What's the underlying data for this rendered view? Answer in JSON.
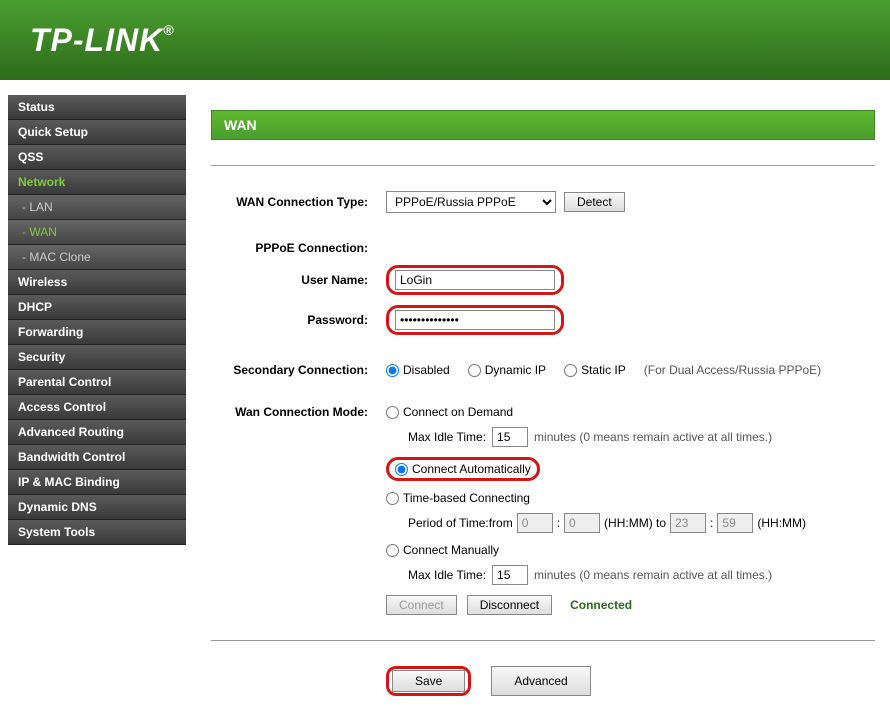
{
  "brand": "TP-LINK",
  "sidebar": {
    "items": [
      {
        "label": "Status",
        "type": "item"
      },
      {
        "label": "Quick Setup",
        "type": "item"
      },
      {
        "label": "QSS",
        "type": "item"
      },
      {
        "label": "Network",
        "type": "item",
        "active": true
      },
      {
        "label": "- LAN",
        "type": "sub"
      },
      {
        "label": "- WAN",
        "type": "sub",
        "active": true
      },
      {
        "label": "- MAC Clone",
        "type": "sub"
      },
      {
        "label": "Wireless",
        "type": "item"
      },
      {
        "label": "DHCP",
        "type": "item"
      },
      {
        "label": "Forwarding",
        "type": "item"
      },
      {
        "label": "Security",
        "type": "item"
      },
      {
        "label": "Parental Control",
        "type": "item"
      },
      {
        "label": "Access Control",
        "type": "item"
      },
      {
        "label": "Advanced Routing",
        "type": "item"
      },
      {
        "label": "Bandwidth Control",
        "type": "item"
      },
      {
        "label": "IP & MAC Binding",
        "type": "item"
      },
      {
        "label": "Dynamic DNS",
        "type": "item"
      },
      {
        "label": "System Tools",
        "type": "item"
      }
    ]
  },
  "page": {
    "title": "WAN",
    "wan_conn_type_label": "WAN Connection Type:",
    "wan_conn_type_value": "PPPoE/Russia PPPoE",
    "detect_btn": "Detect",
    "pppoe_section": "PPPoE Connection:",
    "username_label": "User Name:",
    "username_value": "LoGin",
    "password_label": "Password:",
    "password_value": "••••••••••••••",
    "secondary_label": "Secondary Connection:",
    "secondary_options": {
      "disabled": "Disabled",
      "dynamic": "Dynamic IP",
      "static": "Static IP"
    },
    "secondary_help": "(For Dual Access/Russia PPPoE)",
    "wan_mode_label": "Wan Connection Mode:",
    "mode_demand": "Connect on Demand",
    "mode_auto": "Connect Automatically",
    "mode_time": "Time-based Connecting",
    "mode_manual": "Connect Manually",
    "max_idle_label": "Max Idle Time:",
    "max_idle_value": "15",
    "max_idle_help": "minutes (0 means remain active at all times.)",
    "period_label": "Period of Time:from",
    "period_from_h": "0",
    "period_from_m": "0",
    "period_to_h": "23",
    "period_to_m": "59",
    "period_to_label": "(HH:MM) to",
    "period_end_label": "(HH:MM)",
    "connect_btn": "Connect",
    "disconnect_btn": "Disconnect",
    "status": "Connected",
    "save_btn": "Save",
    "advanced_btn": "Advanced"
  }
}
